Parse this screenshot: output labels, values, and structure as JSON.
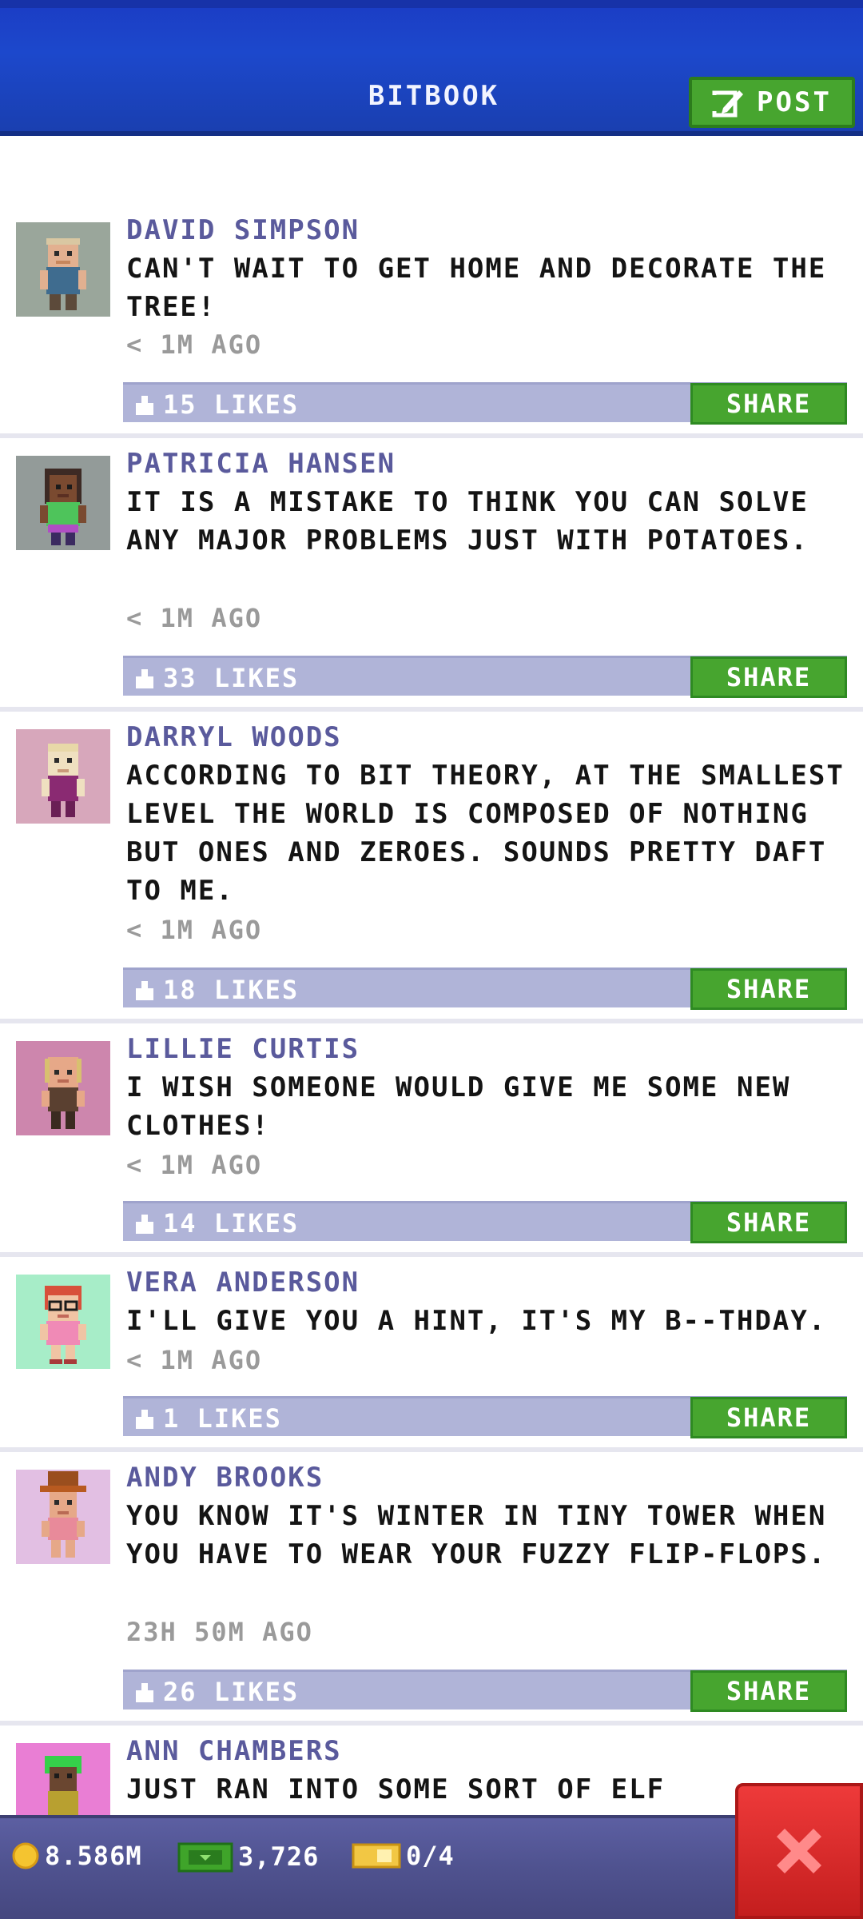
{
  "header": {
    "title": "BITBOOK",
    "post_label": "POST"
  },
  "posts": [
    {
      "name": "DAVID SIMPSON",
      "text": "CAN'T WAIT TO GET HOME AND DECORATE THE TREE!",
      "time": "< 1M AGO",
      "likes": "15 LIKES",
      "share": "SHARE",
      "avatar_bg": "#9aa69b"
    },
    {
      "name": "PATRICIA HANSEN",
      "text": "IT IS A MISTAKE TO THINK YOU CAN SOLVE ANY MAJOR PROBLEMS JUST WITH POTATOES.",
      "time": "< 1M AGO",
      "likes": "33 LIKES",
      "share": "SHARE",
      "avatar_bg": "#939b99"
    },
    {
      "name": "DARRYL WOODS",
      "text": "ACCORDING TO BIT THEORY, AT THE SMALLEST LEVEL THE WORLD IS COMPOSED OF NOTHING BUT ONES AND ZEROES. SOUNDS PRETTY DAFT TO ME.",
      "time": "< 1M AGO",
      "likes": "18 LIKES",
      "share": "SHARE",
      "avatar_bg": "#d7a7bb"
    },
    {
      "name": "LILLIE CURTIS",
      "text": "I WISH SOMEONE WOULD GIVE ME SOME NEW CLOTHES!",
      "time": "< 1M AGO",
      "likes": "14 LIKES",
      "share": "SHARE",
      "avatar_bg": "#cd86ad"
    },
    {
      "name": "VERA ANDERSON",
      "text": "I'LL GIVE YOU A HINT, IT'S MY B--THDAY.",
      "time": "< 1M AGO",
      "likes": "1 LIKES",
      "share": "SHARE",
      "avatar_bg": "#a7edc8"
    },
    {
      "name": "ANDY BROOKS",
      "text": "YOU KNOW IT'S WINTER IN TINY TOWER WHEN YOU HAVE TO WEAR YOUR FUZZY FLIP-FLOPS.",
      "time": "23H 50M AGO",
      "likes": "26 LIKES",
      "share": "SHARE",
      "avatar_bg": "#e2bfe3"
    },
    {
      "name": "ANN CHAMBERS",
      "text": "JUST RAN INTO SOME SORT OF ELF",
      "avatar_bg": "#e97ed4"
    }
  ],
  "bottom_bar": {
    "coins": "8.586M",
    "bux": "3,726",
    "tickets": "0/4"
  },
  "colors": {
    "header_blue": "#1c48cc",
    "share_green": "#47a52f",
    "name_purple": "#5a5a9c",
    "like_bar": "#b0b4d8",
    "close_red": "#d82a2a"
  }
}
